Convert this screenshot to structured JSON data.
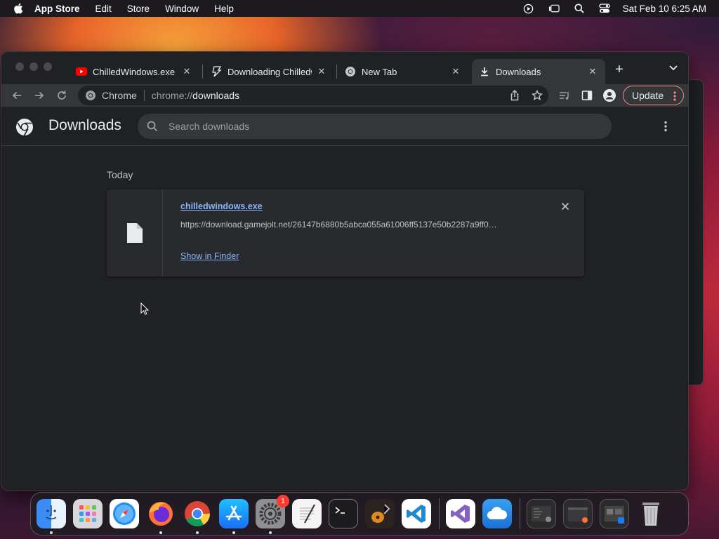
{
  "menubar": {
    "app_name": "App Store",
    "menus": [
      "Edit",
      "Store",
      "Window",
      "Help"
    ],
    "clock": "Sat Feb 10  6:25 AM"
  },
  "browser": {
    "tabs": [
      {
        "title": "ChilledWindows.exe on",
        "favicon": "youtube-icon"
      },
      {
        "title": "Downloading Chilledwi",
        "favicon": "gamejolt-icon"
      },
      {
        "title": "New Tab",
        "favicon": "chrome-icon"
      },
      {
        "title": "Downloads",
        "favicon": "download-icon",
        "active": true
      }
    ],
    "omnibox": {
      "chip_label": "Chrome",
      "url_scheme": "chrome://",
      "url_host": "downloads"
    },
    "update_label": "Update"
  },
  "downloads": {
    "title": "Downloads",
    "search_placeholder": "Search downloads",
    "section_date": "Today",
    "items": [
      {
        "file_name": "chilledwindows.exe",
        "url": "https://download.gamejolt.net/26147b6880b5abca055a61006ff5137e50b2287a9ff0…",
        "action": "Show in Finder"
      }
    ]
  },
  "dock": {
    "apps": [
      "Finder",
      "Launchpad",
      "Safari",
      "Firefox",
      "Google Chrome",
      "App Store",
      "System Settings",
      "TextEdit",
      "Terminal",
      "GarageBand",
      "Visual Studio Code",
      "Visual Studio",
      "iCloud"
    ],
    "settings_badge": "1"
  },
  "colors": {
    "accent_link": "#8ab4f8",
    "update_border": "#f28b82",
    "page_bg": "#202124"
  }
}
